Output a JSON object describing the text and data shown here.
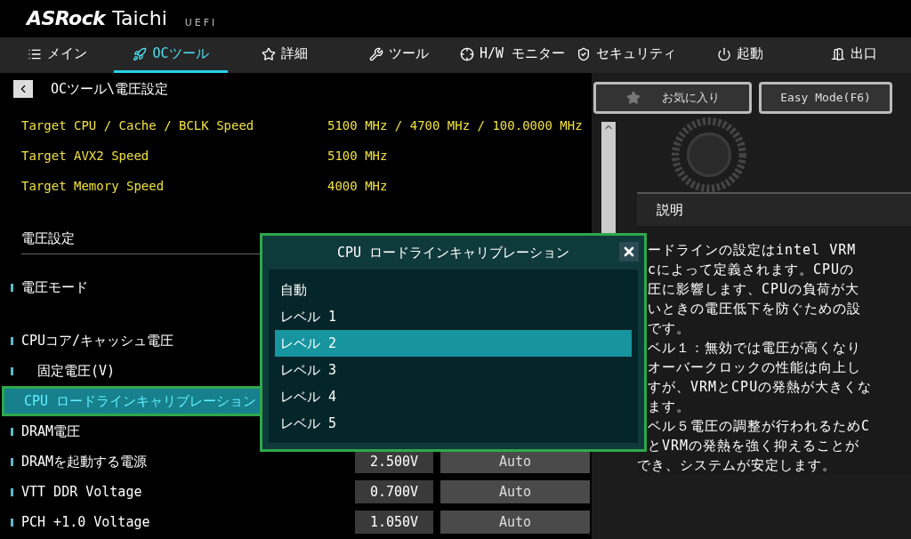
{
  "logo": {
    "brand": "ASRock",
    "product": "Taichi",
    "suffix": "UEFI"
  },
  "tabs": [
    {
      "label": "メイン",
      "selected": false
    },
    {
      "label": "OCツール",
      "selected": true
    },
    {
      "label": "詳細",
      "selected": false
    },
    {
      "label": "ツール",
      "selected": false
    },
    {
      "label": "H/W モニター",
      "selected": false
    },
    {
      "label": "セキュリティ",
      "selected": false
    },
    {
      "label": "起動",
      "selected": false
    },
    {
      "label": "出口",
      "selected": false
    }
  ],
  "breadcrumb": "OCツール\\電圧設定",
  "info_rows": [
    {
      "label": "Target CPU / Cache / BCLK Speed",
      "value": "5100 MHz / 4700 MHz / 100.0000 MHz"
    },
    {
      "label": "Target AVX2 Speed",
      "value": "5100 MHz"
    },
    {
      "label": "Target Memory Speed",
      "value": "4000 MHz"
    }
  ],
  "section_title": "電圧設定",
  "settings": [
    {
      "label": "電圧モード",
      "selected": false
    },
    {
      "label": "CPUコア/キャッシュ電圧",
      "selected": false,
      "children": [
        {
          "label": "固定電圧(V)",
          "selected": false
        }
      ]
    },
    {
      "label": "CPU ロードラインキャリブレーション",
      "selected": true
    },
    {
      "label": "DRAM電圧",
      "selected": false
    },
    {
      "label": "DRAMを起動する電源",
      "selected": false,
      "value": "2.500V",
      "option": "Auto"
    },
    {
      "label": "VTT DDR Voltage",
      "selected": false,
      "value": "0.700V",
      "option": "Auto"
    },
    {
      "label": "PCH +1.0 Voltage",
      "selected": false,
      "value": "1.050V",
      "option": "Auto"
    }
  ],
  "buttons": [
    {
      "label": "お気に入り"
    },
    {
      "label": "Easy Mode(F6)"
    }
  ],
  "description": {
    "title": "説明",
    "lines": [
      "ードラインの設定はintel VRM",
      "cによって定義されます。CPUの",
      "圧に影響します、CPUの負荷が大",
      "いときの電圧低下を防ぐための設",
      "です。",
      "ベル１：無効では電圧が高くなり",
      "オーバークロックの性能は向上し",
      "すが、VRMとCPUの発熱が大きくな",
      "ます。",
      "ベル５電圧の調整が行われるためC",
      "とVRMの発熱を強く抑えることが",
      "でき、システムが安定します。"
    ]
  },
  "popup": {
    "title": "CPU ロードラインキャリブレーション",
    "options": [
      {
        "label": "自動",
        "selected": false
      },
      {
        "label": "レベル 1",
        "selected": false
      },
      {
        "label": "レベル 2",
        "selected": true
      },
      {
        "label": "レベル 3",
        "selected": false
      },
      {
        "label": "レベル 4",
        "selected": false
      },
      {
        "label": "レベル 5",
        "selected": false
      }
    ]
  }
}
